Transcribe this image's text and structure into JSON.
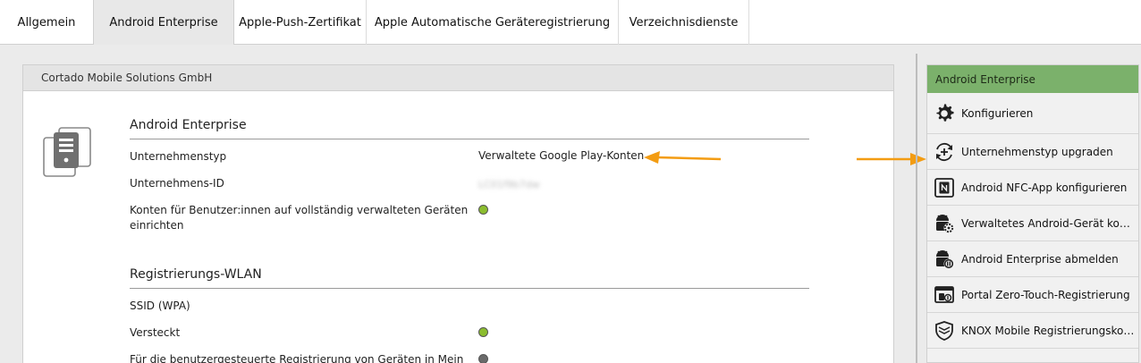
{
  "tabs": [
    {
      "label": "Allgemein"
    },
    {
      "label": "Android Enterprise"
    },
    {
      "label": "Apple-Push-Zertifikat"
    },
    {
      "label": "Apple Automatische Geräteregistrierung"
    },
    {
      "label": "Verzeichnisdienste"
    }
  ],
  "panel": {
    "title": "Cortado Mobile Solutions GmbH",
    "section1": {
      "title": "Android Enterprise",
      "rows": [
        {
          "label": "Unternehmenstyp",
          "value": "Verwaltete Google Play-Konten"
        },
        {
          "label": "Unternehmens-ID",
          "value": "LC01f9b7dw"
        },
        {
          "label": "Konten für Benutzer:innen auf vollständig verwalteten Geräten einrichten",
          "status": "enabled"
        }
      ]
    },
    "section2": {
      "title": "Registrierungs-WLAN",
      "rows": [
        {
          "label": "SSID (WPA)"
        },
        {
          "label": "Versteckt",
          "status": "enabled"
        },
        {
          "label": "Für die benutzergesteuerte Registrierung von Geräten in Mein",
          "status": "disabled"
        }
      ]
    }
  },
  "sidebar": {
    "title": "Android Enterprise",
    "items": [
      {
        "label": "Konfigurieren",
        "icon": "gear-icon"
      },
      {
        "label": "Unternehmenstyp upgraden",
        "icon": "upgrade-icon"
      },
      {
        "label": "Android NFC-App konfigurieren",
        "icon": "nfc-icon"
      },
      {
        "label": "Verwaltetes Android-Gerät konfigurieren",
        "icon": "android-gear-icon"
      },
      {
        "label": "Android Enterprise abmelden",
        "icon": "android-pause-icon"
      },
      {
        "label": "Portal Zero-Touch-Registrierung",
        "icon": "portal-icon"
      },
      {
        "label": "KNOX Mobile Registrierungskonfiguration",
        "icon": "knox-shield-icon"
      }
    ]
  },
  "colors": {
    "accent_green": "#7bb16b",
    "status_green": "#8bbd2f",
    "status_grey": "#6a6a6a",
    "arrow_orange": "#f39c12"
  }
}
